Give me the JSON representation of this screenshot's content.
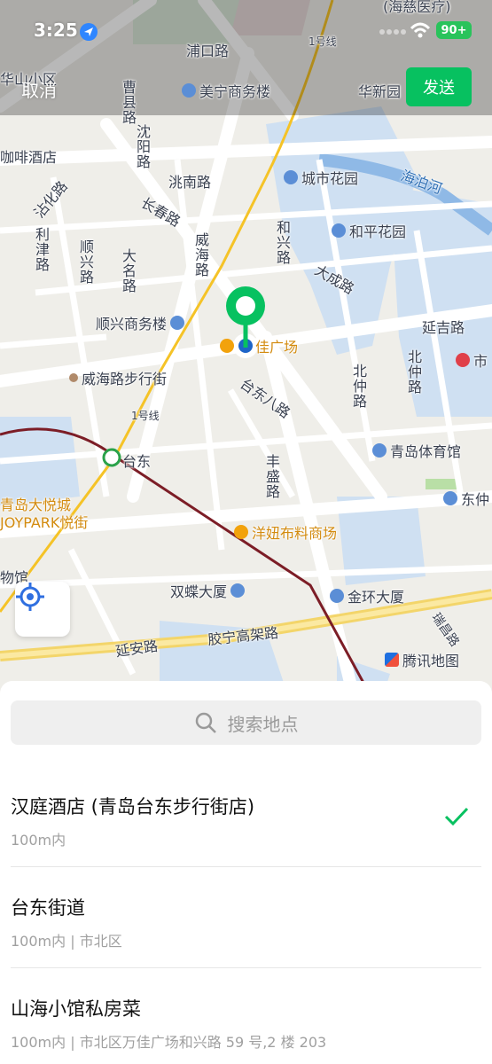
{
  "status_bar": {
    "time": "3:25",
    "battery": "90+"
  },
  "top_bar": {
    "cancel_label": "取消",
    "send_label": "发送"
  },
  "map": {
    "labels": {
      "puko_road": "浦口路",
      "metro_1": "1号线",
      "metro_2": "1号线",
      "meining": "美宁商务楼",
      "huaxin": "华新园",
      "haici": "(海慈医疗)",
      "caoxian": "曹县路",
      "shenyang": "沈阳路",
      "taoman": "洮南路",
      "huashan": "华山小区",
      "cafe_hotel": "咖啡酒店",
      "chengshi": "城市花园",
      "haibo": "海泊河",
      "zhanhua": "沾化路",
      "lijin": "利津路",
      "changchun": "长春路",
      "shunxing_road": "顺兴路",
      "daming": "大名路",
      "weihai_road": "威海路",
      "hexing": "和兴路",
      "heping": "和平花园",
      "dacheng": "大成路",
      "yanji": "延吉路",
      "shunxing_bldg": "顺兴商务楼",
      "jiajia": "佳广场",
      "weihai_walk": "威海路步行街",
      "taidong8": "台东八路",
      "beizhong": "北仲路",
      "qingdao_gym": "青岛体育馆",
      "shi": "市",
      "taidong": "台东",
      "fengsheng": "丰盛路",
      "dongzhong": "东仲",
      "joycity": "青岛大悦城",
      "joypark": "JOYPARK悦街",
      "yangniu": "洋妞布料商场",
      "wuguan": "物馆",
      "shuangdie": "双蝶大厦",
      "jinhuan": "金环大厦",
      "jiaoning": "胶宁高架路",
      "yanan": "延安路",
      "tencent_map": "腾讯地图",
      "shiyu": "瑞昌路"
    }
  },
  "search": {
    "placeholder": "搜索地点"
  },
  "results": [
    {
      "title": "汉庭酒店 (青岛台东步行街店)",
      "subtitle": "100m内",
      "selected": true
    },
    {
      "title": "台东街道",
      "subtitle": "100m内 | 市北区",
      "selected": false
    },
    {
      "title": "山海小馆私房菜",
      "subtitle": "100m内 | 市北区万佳广场和兴路 59 号,2 楼 203",
      "selected": false
    }
  ],
  "colors": {
    "accent": "#07c160",
    "water": "#bcd3ee",
    "metro": "#f5c327",
    "rail": "#7c1d26",
    "poi_blue": "#5b8ed6",
    "poi_orange": "#f2a20c"
  },
  "icons": {
    "location_arrow": "location-arrow-icon",
    "wifi": "wifi-icon",
    "locate": "locate-icon",
    "search": "search-icon",
    "check": "check-icon"
  }
}
